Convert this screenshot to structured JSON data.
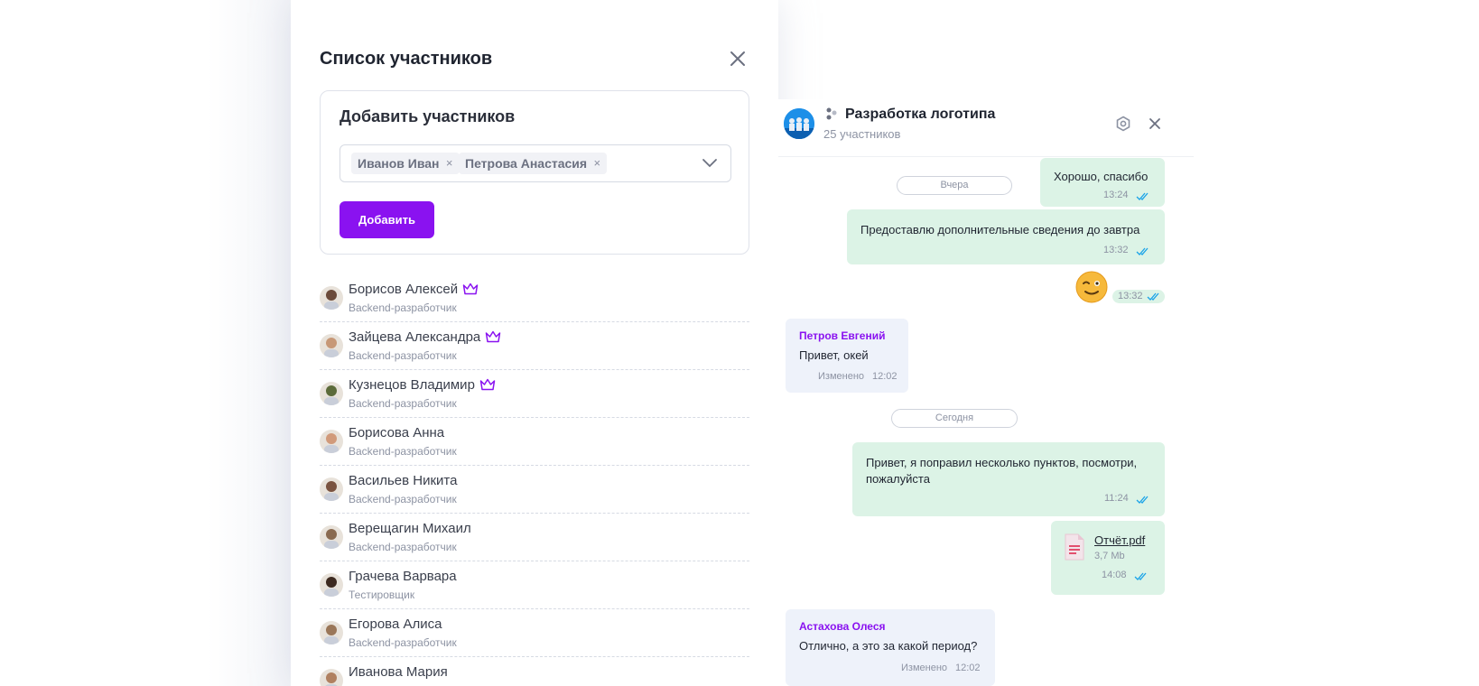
{
  "modal": {
    "title": "Список участников",
    "add_section": {
      "title": "Добавить участников",
      "selected": [
        "Иванов Иван",
        "Петрова Анастасия"
      ],
      "chip_remove": "×",
      "add_button": "Добавить"
    },
    "members": [
      {
        "name": "Борисов Алексей",
        "role": "Backend-разработчик",
        "admin": true,
        "skin": "#6b4a3a"
      },
      {
        "name": "Зайцева Александра",
        "role": "Backend-разработчик",
        "admin": true,
        "skin": "#c79877"
      },
      {
        "name": "Кузнецов Владимир",
        "role": "Backend-разработчик",
        "admin": true,
        "skin": "#5c6b3a"
      },
      {
        "name": "Борисова Анна",
        "role": "Backend-разработчик",
        "admin": false,
        "skin": "#d19a7a"
      },
      {
        "name": "Васильев Никита",
        "role": "Backend-разработчик",
        "admin": false,
        "skin": "#7a5340"
      },
      {
        "name": "Верещагин Михаил",
        "role": "Backend-разработчик",
        "admin": false,
        "skin": "#8a6a50"
      },
      {
        "name": "Грачева Варвара",
        "role": "Тестировщик",
        "admin": false,
        "skin": "#3d2a20"
      },
      {
        "name": "Егорова Алиса",
        "role": "Backend-разработчик",
        "admin": false,
        "skin": "#9a7658"
      },
      {
        "name": "Иванова Мария",
        "role": "",
        "admin": false,
        "skin": "#b08060"
      }
    ]
  },
  "chat": {
    "title": "Разработка логотипа",
    "subtitle": "25 участников",
    "messages": {
      "m1_text": "Хорошо, спасибо",
      "m1_time": "13:24",
      "date1": "Вчера",
      "m2_text": "Предоставлю дополнительные сведения до завтра",
      "m2_time": "13:32",
      "emoji_time": "13:32",
      "m3_sender": "Петров Евгений",
      "m3_text": "Привет, окей",
      "m3_edited": "Изменено",
      "m3_time": "12:02",
      "date2": "Сегодня",
      "m4_text_line1": "Привет, я поправил несколько пунктов, посмотри,",
      "m4_text_line2": "пожалуйста",
      "m4_time": "11:24",
      "file_name": "Отчёт.pdf",
      "file_size": "3,7 Mb",
      "file_time": "14:08",
      "m5_sender": "Астахова Олеся",
      "m5_text": "Отлично, а это за какой период?",
      "m5_edited": "Изменено",
      "m5_time": "12:02"
    }
  },
  "colors": {
    "accent": "#8a12f0",
    "outgoing_bubble": "#dcf3e6",
    "incoming_bubble": "#eef2fa",
    "tick": "#1aa3e8"
  }
}
